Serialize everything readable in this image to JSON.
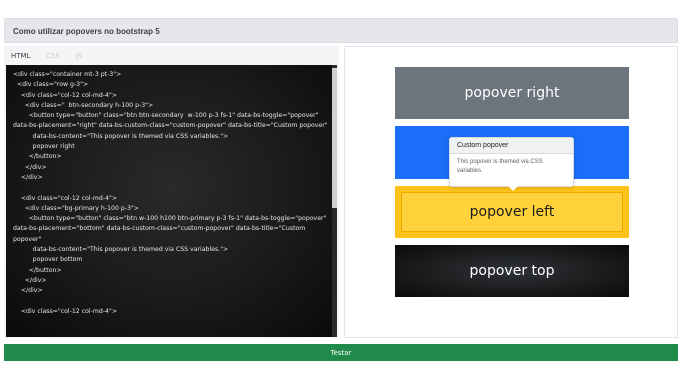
{
  "title_bar": {
    "text": "Como utilizar popovers no bootstrap 5"
  },
  "editor": {
    "tabs": [
      {
        "label": "HTML",
        "active": true
      },
      {
        "label": "CSS",
        "active": false
      },
      {
        "label": "JS",
        "active": false
      }
    ],
    "code_lines": [
      "<div class=\"container mt-3 pt-3\">",
      "  <div class=\"row g-3\">",
      "    <div class=\"col-12 col-md-4\">",
      "      <div class=\"  btn-secondary h-100 p-3\">",
      "        <button type=\"button\" class=\"btn btn-secondary  w-100 p-3 fs-1\" data-bs-toggle=\"popover\" data-bs-placement=\"right\" data-bs-custom-class=\"custom-popover\" data-bs-title=\"Custom popover\"",
      "          data-bs-content=\"This popover is themed via CSS variables.\">",
      "          popover right",
      "        </button>",
      "      </div>",
      "    </div>",
      "",
      "    <div class=\"col-12 col-md-4\">",
      "      <div class=\"bg-primary h-100 p-3\">",
      "        <button type=\"button\" class=\"btn w-100 h100 btn-primary p-3 fs-1\" data-bs-toggle=\"popover\" data-bs-placement=\"bottom\" data-bs-custom-class=\"custom-popover\" data-bs-title=\"Custom popover\"",
      "          data-bs-content=\"This popover is themed via CSS variables.\">",
      "          popover bottom",
      "        </button>",
      "      </div>",
      "    </div>",
      "",
      "    <div class=\"col-12 col-md-4\">"
    ]
  },
  "preview": {
    "btn_right": "popover right",
    "btn_left": "popover left",
    "btn_top": "popover top",
    "popover": {
      "title": "Custom popover",
      "body": "This popover is themed via CSS variables."
    }
  },
  "run_button": {
    "label": "Testar"
  },
  "colors": {
    "secondary": "#6c757d",
    "primary": "#1a6ef7",
    "warning": "#fcc419",
    "dark": "#151617",
    "success": "#1f8a4a"
  }
}
